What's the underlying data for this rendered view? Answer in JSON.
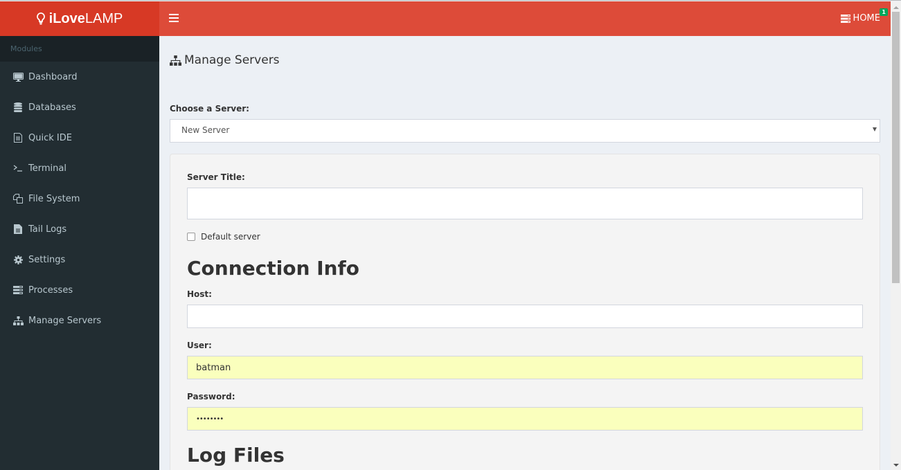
{
  "app": {
    "logo_bold": "iLove",
    "logo_light": "LAMP",
    "logo_icon": "lightbulb-icon"
  },
  "navbar": {
    "menu_icon": "hamburger-icon",
    "home_label": "HOME",
    "home_icon": "server-icon",
    "notification_count": "1",
    "badge_color": "#00a65a"
  },
  "colors": {
    "logo_bg": "#d73925",
    "navbar_bg": "#dd4b39",
    "sidebar_bg": "#222d32",
    "autofill_bg": "#faffbd"
  },
  "sidebar": {
    "header": "Modules",
    "items": [
      {
        "label": "Dashboard",
        "icon": "desktop-icon"
      },
      {
        "label": "Databases",
        "icon": "database-icon"
      },
      {
        "label": "Quick IDE",
        "icon": "file-text-icon"
      },
      {
        "label": "Terminal",
        "icon": "terminal-icon"
      },
      {
        "label": "File System",
        "icon": "files-icon"
      },
      {
        "label": "Tail Logs",
        "icon": "file-icon"
      },
      {
        "label": "Settings",
        "icon": "gear-icon"
      },
      {
        "label": "Processes",
        "icon": "server-icon"
      },
      {
        "label": "Manage Servers",
        "icon": "sitemap-icon"
      }
    ]
  },
  "main": {
    "page_title": "Manage Servers",
    "choose_label": "Choose a Server:",
    "server_select": {
      "selected": "New Server"
    },
    "form": {
      "server_title_label": "Server Title:",
      "server_title_value": "",
      "default_server_label": "Default server",
      "default_server_checked": false,
      "connection_heading": "Connection Info",
      "host_label": "Host:",
      "host_value": "",
      "user_label": "User:",
      "user_value": "batman",
      "password_label": "Password:",
      "password_value": "••••••••",
      "log_files_heading": "Log Files"
    }
  }
}
